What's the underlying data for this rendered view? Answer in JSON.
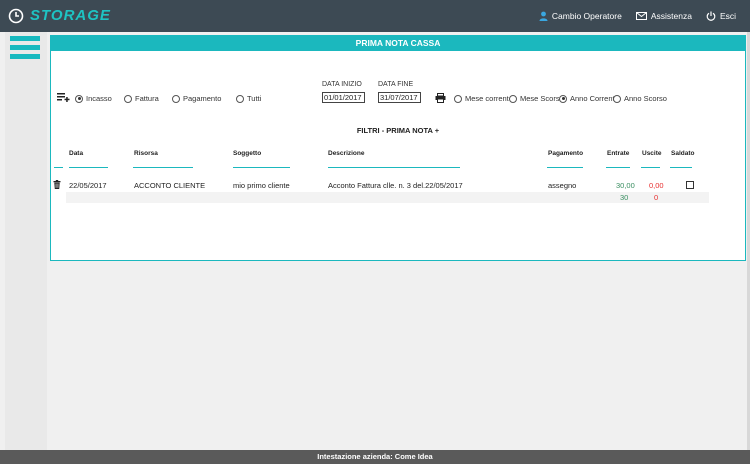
{
  "app": {
    "logo_text": "STORAGE",
    "accent": "#1bb8be",
    "topbar_bg": "#3d4a54"
  },
  "topnav": {
    "cambio_operatore": "Cambio Operatore",
    "assistenza": "Assistenza",
    "esci": "Esci"
  },
  "panel": {
    "title": "PRIMA NOTA CASSA"
  },
  "filters": {
    "type_options": [
      {
        "label": "Incasso",
        "selected": true
      },
      {
        "label": "Fattura",
        "selected": false
      },
      {
        "label": "Pagamento",
        "selected": false
      },
      {
        "label": "Tutti",
        "selected": false
      }
    ],
    "data_inizio_label": "DATA INIZIO",
    "data_inizio_value": "01/01/2017",
    "data_fine_label": "DATA FINE",
    "data_fine_value": "31/07/2017",
    "period_options": [
      {
        "label": "Mese corrente",
        "selected": false
      },
      {
        "label": "Mese Scorso",
        "selected": false
      },
      {
        "label": "Anno Corrente",
        "selected": true
      },
      {
        "label": "Anno Scorso",
        "selected": false
      }
    ],
    "section_title": "FILTRI - PRIMA NOTA +"
  },
  "table": {
    "headers": {
      "data": "Data",
      "risorsa": "Risorsa",
      "soggetto": "Soggetto",
      "descrizione": "Descrizione",
      "pagamento": "Pagamento",
      "entrate": "Entrate",
      "uscite": "Uscite",
      "saldato": "Saldato"
    },
    "rows": [
      {
        "data": "22/05/2017",
        "risorsa": "ACCONTO CLIENTE",
        "soggetto": "mio primo cliente",
        "descrizione": "Acconto Fattura clle. n. 3 del.22/05/2017",
        "pagamento": "assegno",
        "entrate": "30,00",
        "uscite": "0,00",
        "saldato": false
      }
    ],
    "totals": {
      "entrate": "30",
      "uscite": "0"
    }
  },
  "footer": {
    "text": "Intestazione azienda: Come Idea"
  }
}
